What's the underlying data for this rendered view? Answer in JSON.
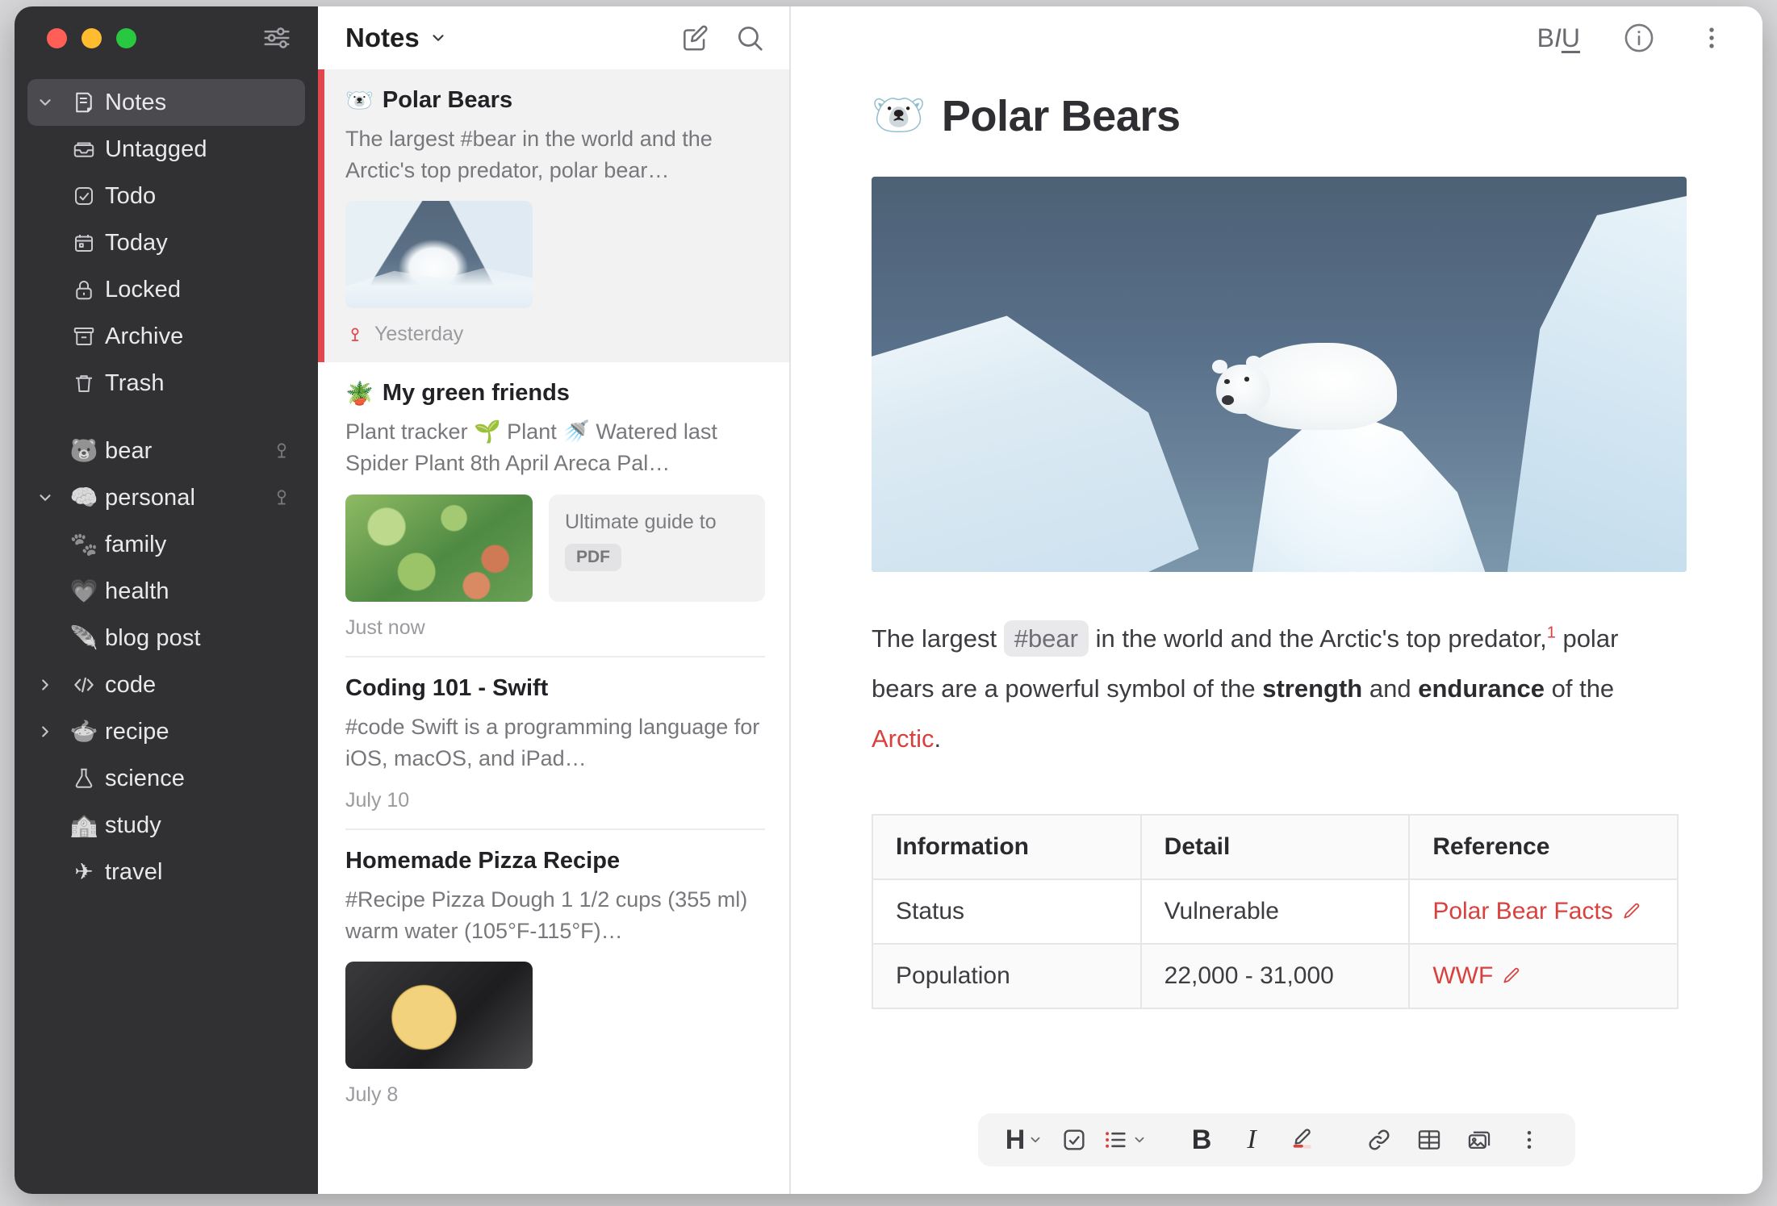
{
  "window": {
    "traffic_lights": [
      "close",
      "minimize",
      "zoom"
    ],
    "sidebar_settings_icon": "sliders-icon"
  },
  "sidebar": {
    "items": [
      {
        "label": "Notes",
        "icon": "note-icon",
        "level": 0,
        "twisty": "down",
        "selected": true,
        "pin": false
      },
      {
        "label": "Untagged",
        "icon": "inbox-icon",
        "level": 1,
        "twisty": "",
        "selected": false,
        "pin": false
      },
      {
        "label": "Todo",
        "icon": "checkbox-icon",
        "level": 1,
        "twisty": "",
        "selected": false,
        "pin": false
      },
      {
        "label": "Today",
        "icon": "calendar-icon",
        "level": 1,
        "twisty": "",
        "selected": false,
        "pin": false
      },
      {
        "label": "Locked",
        "icon": "lock-icon",
        "level": 1,
        "twisty": "",
        "selected": false,
        "pin": false
      },
      {
        "label": "Archive",
        "icon": "archive-icon",
        "level": 0,
        "twisty": "",
        "selected": false,
        "pin": false
      },
      {
        "label": "Trash",
        "icon": "trash-icon",
        "level": 0,
        "twisty": "",
        "selected": false,
        "pin": false
      }
    ],
    "tags": [
      {
        "label": "bear",
        "icon": "🐻",
        "level": 0,
        "twisty": "",
        "pin": true
      },
      {
        "label": "personal",
        "icon": "🧠",
        "level": 0,
        "twisty": "down",
        "pin": true
      },
      {
        "label": "family",
        "icon": "🐾",
        "level": 1,
        "twisty": "",
        "pin": false
      },
      {
        "label": "health",
        "icon": "💗",
        "level": 1,
        "twisty": "",
        "pin": false
      },
      {
        "label": "blog post",
        "icon": "🪶",
        "level": 0,
        "twisty": "",
        "pin": false
      },
      {
        "label": "code",
        "icon": "code",
        "level": 0,
        "twisty": "right",
        "pin": false
      },
      {
        "label": "recipe",
        "icon": "🍲",
        "level": 0,
        "twisty": "right",
        "pin": false
      },
      {
        "label": "science",
        "icon": "⚗",
        "level": 0,
        "twisty": "",
        "pin": false
      },
      {
        "label": "study",
        "icon": "🏫",
        "level": 0,
        "twisty": "",
        "pin": false
      },
      {
        "label": "travel",
        "icon": "✈",
        "level": 0,
        "twisty": "",
        "pin": false
      }
    ]
  },
  "notelist": {
    "title": "Notes",
    "chevron": "chevron-down-icon",
    "compose_icon": "compose-icon",
    "search_icon": "search-icon",
    "notes": [
      {
        "emoji": "🐻‍❄️",
        "title": "Polar Bears",
        "snippet": "The largest #bear in the world and the Arctic's top predator, polar bear…",
        "timestamp": "Yesterday",
        "pinned": true,
        "active": true,
        "thumb": "bear",
        "attachment": null
      },
      {
        "emoji": "🪴",
        "title": "My green friends",
        "snippet": "Plant tracker 🌱 Plant 🚿 Watered last Spider Plant 8th April Areca Pal…",
        "timestamp": "Just now",
        "pinned": false,
        "active": false,
        "thumb": "plants",
        "attachment": {
          "name": "Ultimate guide to",
          "kind": "PDF"
        }
      },
      {
        "emoji": "",
        "title": "Coding 101 - Swift",
        "snippet": "#code Swift is a programming language for iOS, macOS, and iPad…",
        "timestamp": "July 10",
        "pinned": false,
        "active": false,
        "thumb": null,
        "attachment": null
      },
      {
        "emoji": "",
        "title": "Homemade Pizza Recipe",
        "snippet": "#Recipe Pizza Dough 1 1/2 cups (355 ml) warm water (105°F-115°F)…",
        "timestamp": "July 8",
        "pinned": false,
        "active": false,
        "thumb": "pizza",
        "attachment": null
      }
    ]
  },
  "editor": {
    "header_icons": {
      "format_b": "B",
      "format_i": "I",
      "format_u": "U",
      "info": "info-icon",
      "more": "more-vertical-icon"
    },
    "title_emoji": "🐻‍❄️",
    "title": "Polar Bears",
    "paragraph": {
      "p1": "The largest",
      "tag": "#bear",
      "p2": "in the world and the Arctic's top predator,",
      "footnote": "1",
      "p3": "polar bears are a powerful symbol of the",
      "bold1": "strength",
      "p4": "and",
      "bold2": "endurance",
      "p5": "of the",
      "link": "Arctic",
      "p6": "."
    },
    "table": {
      "headers": [
        "Information",
        "Detail",
        "Reference"
      ],
      "rows": [
        [
          "Status",
          "Vulnerable",
          "Polar Bear Facts"
        ],
        [
          "Population",
          "22,000 - 31,000",
          "WWF"
        ]
      ]
    },
    "toolbar": [
      {
        "name": "heading-button",
        "label": "H",
        "caret": true
      },
      {
        "name": "checklist-button",
        "label": "",
        "caret": false
      },
      {
        "name": "list-button",
        "label": "",
        "caret": true
      },
      {
        "name": "bold-button",
        "label": "B",
        "caret": false
      },
      {
        "name": "italic-button",
        "label": "I",
        "caret": false
      },
      {
        "name": "highlight-button",
        "label": "",
        "caret": false
      },
      {
        "name": "link-button",
        "label": "",
        "caret": false
      },
      {
        "name": "table-button",
        "label": "",
        "caret": false
      },
      {
        "name": "image-button",
        "label": "",
        "caret": false
      },
      {
        "name": "more-button",
        "label": "",
        "caret": false
      }
    ]
  },
  "colors": {
    "accent_red": "#e2474d",
    "sidebar_bg": "#313134",
    "link_red": "#d9413f"
  }
}
